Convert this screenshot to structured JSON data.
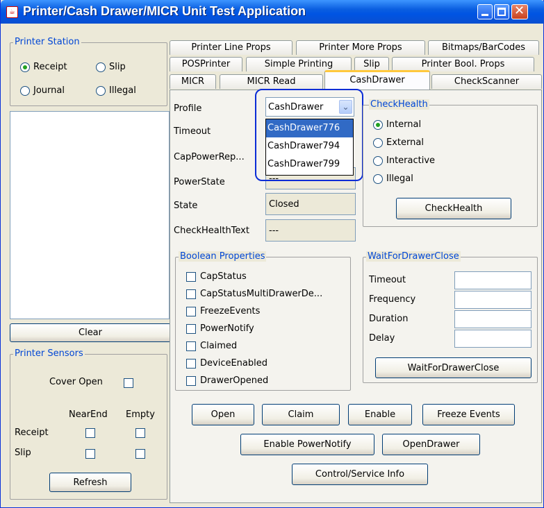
{
  "window": {
    "title": "Printer/Cash Drawer/MICR Unit Test Application",
    "icon": "java-icon"
  },
  "printer_station": {
    "title": "Printer Station",
    "options": [
      "Receipt",
      "Slip",
      "Journal",
      "Illegal"
    ],
    "selected": "Receipt"
  },
  "left": {
    "clear_label": "Clear",
    "sensors": {
      "title": "Printer Sensors",
      "cover_open": "Cover Open",
      "col_nearend": "NearEnd",
      "col_empty": "Empty",
      "row_receipt": "Receipt",
      "row_slip": "Slip",
      "refresh_label": "Refresh"
    }
  },
  "tabs": {
    "row1": [
      "Printer Line Props",
      "Printer More Props",
      "Bitmaps/BarCodes"
    ],
    "row2": [
      "POSPrinter",
      "Simple Printing",
      "Slip",
      "Printer Bool. Props"
    ],
    "row3": [
      "MICR",
      "MICR Read",
      "CashDrawer",
      "CheckScanner"
    ],
    "active": "CashDrawer"
  },
  "props": {
    "profile_label": "Profile",
    "profile_value": "CashDrawer",
    "profile_options": [
      "CashDrawer776",
      "CashDrawer794",
      "CashDrawer799"
    ],
    "timeout_label": "Timeout",
    "cappower_label": "CapPowerRep...",
    "powerstate_label": "PowerState",
    "powerstate_value": "---",
    "state_label": "State",
    "state_value": "Closed",
    "checkhealthtext_label": "CheckHealthText",
    "checkhealthtext_value": "---"
  },
  "checkhealth": {
    "title": "CheckHealth",
    "options": [
      "Internal",
      "External",
      "Interactive",
      "Illegal"
    ],
    "selected": "Internal",
    "button": "CheckHealth"
  },
  "boolean_props": {
    "title": "Boolean Properties",
    "items": [
      "CapStatus",
      "CapStatusMultiDrawerDe...",
      "FreezeEvents",
      "PowerNotify",
      "Claimed",
      "DeviceEnabled",
      "DrawerOpened"
    ]
  },
  "wait": {
    "title": "WaitForDrawerClose",
    "fields": [
      "Timeout",
      "Frequency",
      "Duration",
      "Delay"
    ],
    "button": "WaitForDrawerClose"
  },
  "actions": {
    "open": "Open",
    "claim": "Claim",
    "enable": "Enable",
    "freeze": "Freeze Events",
    "enable_power": "Enable PowerNotify",
    "open_drawer": "OpenDrawer",
    "control_info": "Control/Service Info"
  },
  "colors": {
    "titlebar": "#0054e3",
    "group_title": "#0046d5",
    "highlight": "#316ac5",
    "focus_ring": "#0a2cd6"
  }
}
